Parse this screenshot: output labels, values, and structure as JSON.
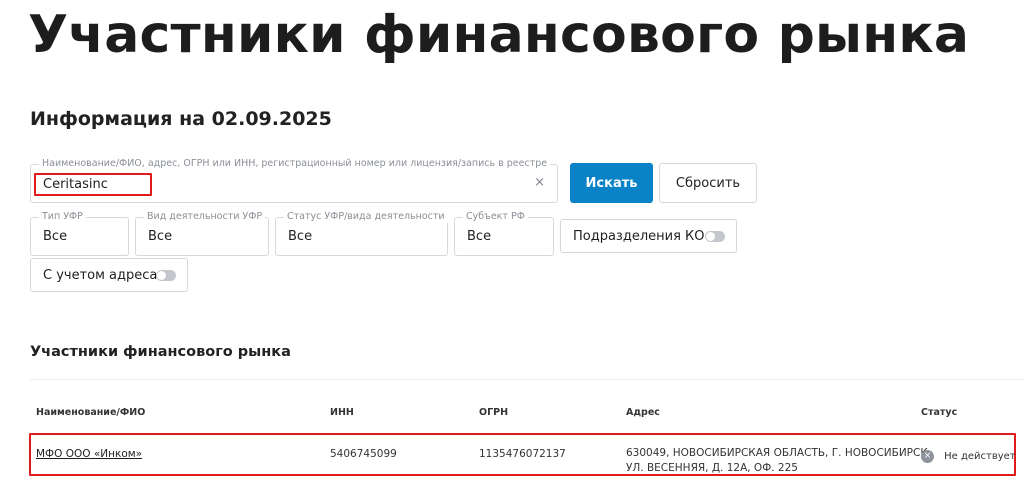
{
  "page": {
    "title": "Участники финансового рынка",
    "info_date": "Информация на 02.09.2025"
  },
  "search": {
    "label": "Наименование/ФИО, адрес, ОГРН или ИНН, регистрационный номер или лицензия/запись в реестре",
    "value": "Ceritasinc",
    "clear_icon": "×",
    "search_button": "Искать",
    "reset_button": "Сбросить"
  },
  "filters": {
    "type": {
      "label": "Тип УФР",
      "value": "Все"
    },
    "activity": {
      "label": "Вид деятельности УФР",
      "value": "Все"
    },
    "status": {
      "label": "Статус УФР/вида деятельности",
      "value": "Все"
    },
    "region": {
      "label": "Субъект РФ",
      "value": "Все"
    },
    "branches_toggle": {
      "label": "Подразделения КО",
      "on": false
    },
    "address_toggle": {
      "label": "С учетом адреса",
      "on": false
    }
  },
  "results": {
    "section_title": "Участники финансового рынка",
    "columns": [
      "Наименование/ФИО",
      "ИНН",
      "ОГРН",
      "Адрес",
      "Статус"
    ],
    "rows": [
      {
        "name": "МФО ООО «Инком»",
        "inn": "5406745099",
        "ogrn": "1135476072137",
        "address_line1": "630049, НОВОСИБИРСКАЯ ОБЛАСТЬ, Г. НОВОСИБИРСК,",
        "address_line2": "УЛ. ВЕСЕННЯЯ, Д. 12А, ОФ. 225",
        "status": "Не действует",
        "status_icon": "×"
      }
    ]
  },
  "colors": {
    "accent": "#0a82c8",
    "highlight": "#e11b1b",
    "status_inactive": "#8e949b"
  }
}
